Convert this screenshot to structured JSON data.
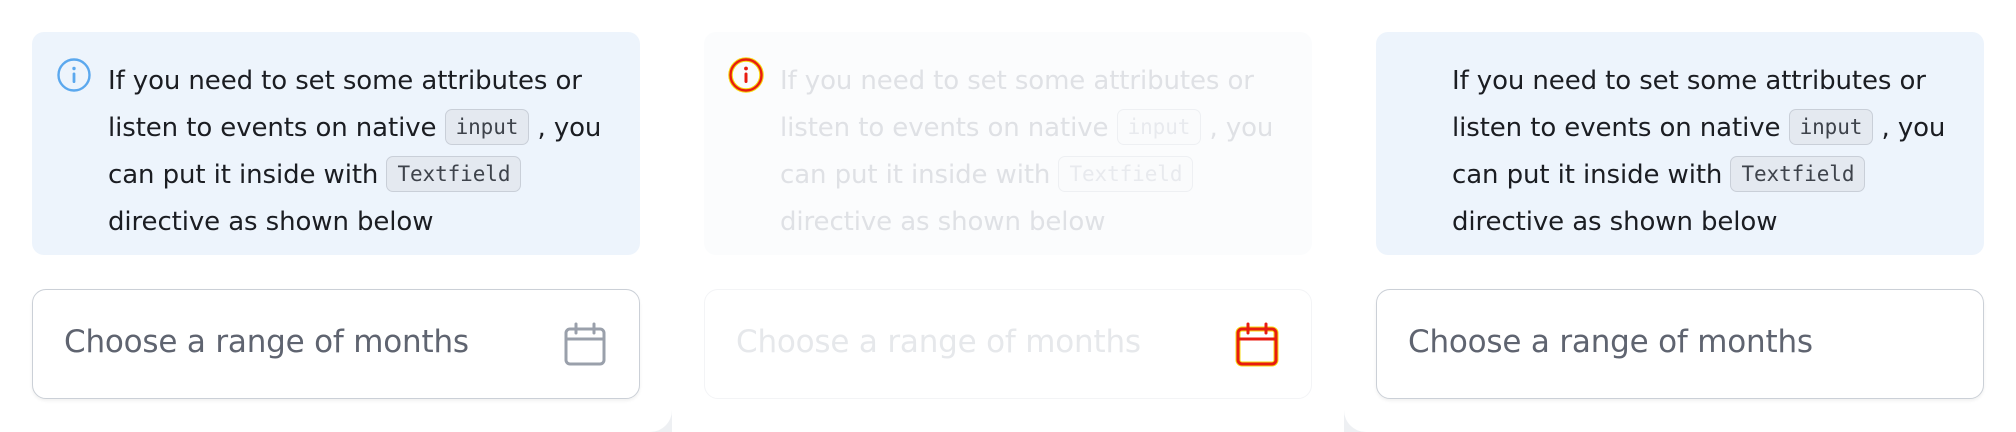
{
  "panels": [
    {
      "info": {
        "icon": "info-circle-icon",
        "line1": "If you need to set some attributes or",
        "line2_pre": "listen to events on native",
        "code1": "input",
        "line2_post": ", you",
        "line3_pre": "can put it inside with",
        "code2": "Textfield",
        "line4": "directive as shown below"
      },
      "field": {
        "placeholder": "Choose a range of months",
        "icon": "calendar-icon"
      }
    },
    {
      "info": {
        "icon": "info-circle-icon",
        "line1": "If you need to set some attributes or",
        "line2_pre": "listen to events on native",
        "code1": "input",
        "line2_post": ", you",
        "line3_pre": "can put it inside with",
        "code2": "Textfield",
        "line4": "directive as shown below"
      },
      "field": {
        "placeholder": "Choose a range of months",
        "icon": "calendar-icon"
      }
    },
    {
      "info": {
        "line1": "If you need to set some attributes or",
        "line2_pre": "listen to events on native",
        "code1": "input",
        "line2_post": ", you",
        "line3_pre": "can put it inside with",
        "code2": "Textfield",
        "line4": "directive as shown below"
      },
      "field": {
        "placeholder": "Choose a range of months"
      }
    }
  ],
  "colors": {
    "info_bg": "#edf4fc",
    "info_icon_blue": "#5ba8ee",
    "highlight_red": "#e81b10",
    "highlight_yellow": "#f5d80f",
    "icon_gray": "#9aa0ab"
  }
}
